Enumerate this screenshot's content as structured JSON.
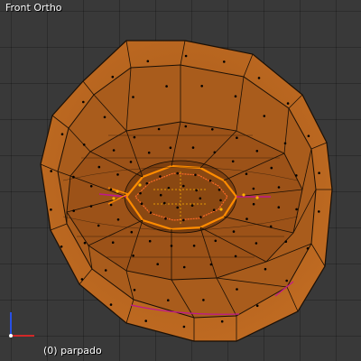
{
  "viewport": {
    "view_name": "Front Ortho",
    "object_info": "(0) parpado",
    "background_color": "#393939",
    "grid_color": "#2c2c2c"
  },
  "mesh": {
    "object_name": "parpado",
    "mode": "edit",
    "shape": "eyelid-ring-mesh",
    "face_color": "#b4631e",
    "edge_color": "#1a0f05",
    "vertex_color": "#000000",
    "selected_edge_color": "#ff8c00",
    "selected_vertex_color": "#ffb400",
    "seam_color": "#c0188c"
  },
  "axes": {
    "icon": "axis-gizmo-icon",
    "x_color": "#d22828",
    "z_color": "#2850e6"
  }
}
